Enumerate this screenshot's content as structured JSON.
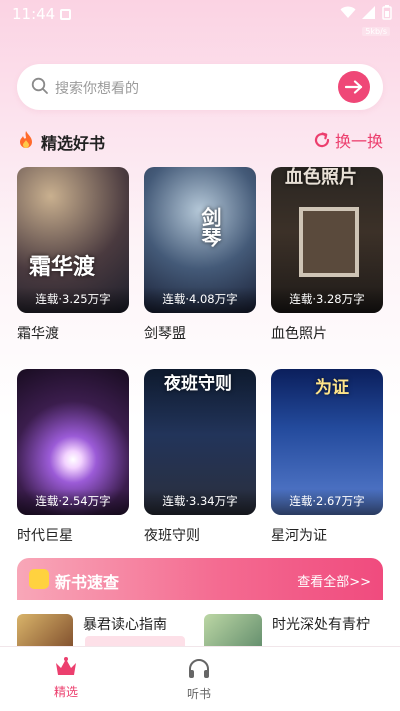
{
  "status": {
    "time": "11:44",
    "net_speed": "5kb/s"
  },
  "search": {
    "placeholder": "搜索你想看的"
  },
  "featured": {
    "title": "精选好书",
    "refresh_label": "换一换",
    "books": [
      {
        "name": "霜华渡",
        "status": "连载·3.25万字",
        "cover_text": "霜华渡"
      },
      {
        "name": "剑琴盟",
        "status": "连载·4.08万字",
        "cover_text": "剑琴"
      },
      {
        "name": "血色照片",
        "status": "连载·3.28万字",
        "cover_text": "血色照片"
      },
      {
        "name": "时代巨星",
        "status": "连载·2.54万字",
        "cover_text": ""
      },
      {
        "name": "夜班守则",
        "status": "连载·3.34万字",
        "cover_text": "夜班守则"
      },
      {
        "name": "星河为证",
        "status": "连载·2.67万字",
        "cover_text": "为证"
      }
    ]
  },
  "new_books": {
    "title": "新书速查",
    "more_label": "查看全部>>",
    "items": [
      {
        "name": "暴君读心指南"
      },
      {
        "name": "时光深处有青柠"
      }
    ]
  },
  "nav": {
    "items": [
      {
        "label": "精选",
        "icon": "crown-icon",
        "active": true
      },
      {
        "label": "听书",
        "icon": "headphones-icon",
        "active": false
      }
    ]
  },
  "colors": {
    "accent": "#ec3f6e",
    "search_button": "#ef4777"
  }
}
